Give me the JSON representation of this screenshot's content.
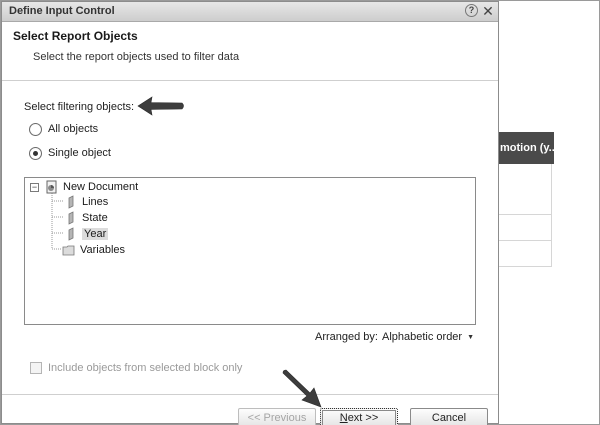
{
  "background": {
    "column_header": "motion (y..."
  },
  "dialog": {
    "title": "Define Input Control",
    "help_glyph": "?",
    "close_glyph": "✕",
    "page_title": "Select Report Objects",
    "page_subtitle": "Select the report objects used to filter data",
    "filter_label": "Select filtering objects:",
    "radio_all": "All objects",
    "radio_single": "Single object",
    "selected_radio": "Single object",
    "tree": {
      "root": "New Document",
      "root_expander": "−",
      "children": [
        "Lines",
        "State",
        "Year",
        "Variables"
      ],
      "selected": "Year"
    },
    "arranged_label": "Arranged by:",
    "arranged_value": "Alphabetic order",
    "arranged_caret": "▼",
    "checkbox_label": "Include objects from selected block only",
    "buttons": {
      "previous": "<< Previous",
      "next_n": "N",
      "next_rest": "ext >>",
      "cancel": "Cancel"
    }
  },
  "colors": {
    "arrow": "#3d3d3d",
    "header_bg": "#4a4a4a",
    "selection_bg": "#dcdcdc"
  }
}
